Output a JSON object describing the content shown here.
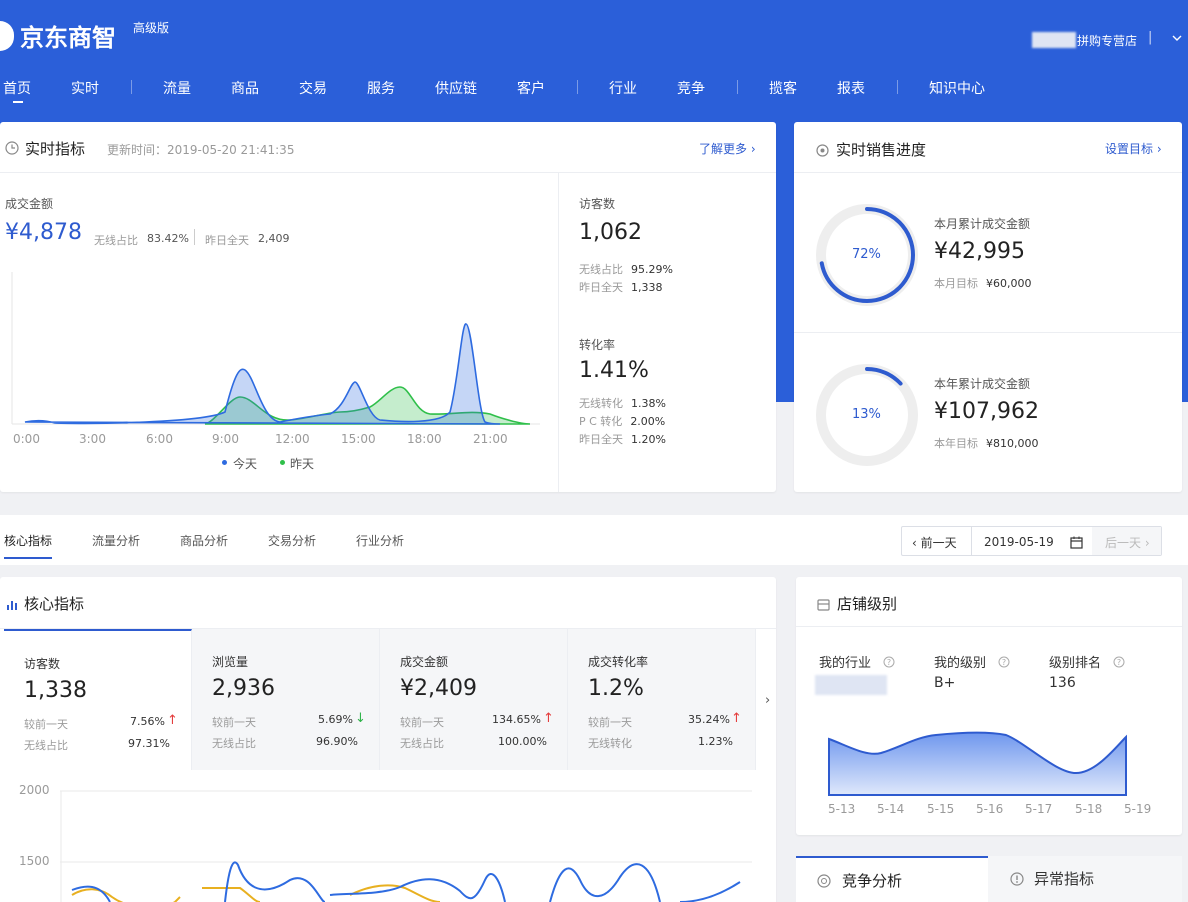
{
  "header": {
    "brand": "京东商智",
    "edition": "高级版",
    "shop_name": "拼购专营店",
    "separator": "|",
    "nav": [
      "首页",
      "实时",
      "流量",
      "商品",
      "交易",
      "服务",
      "供应链",
      "客户",
      "行业",
      "竞争",
      "揽客",
      "报表",
      "知识中心"
    ]
  },
  "realtime": {
    "title": "实时指标",
    "updated": "更新时间：2019-05-20 21:41:35",
    "more": "了解更多 ›",
    "gmv_label": "成交金额",
    "gmv_value": "¥4,878",
    "wireless_label": "无线占比",
    "wireless_value": "83.42%",
    "yesterday_label": "昨日全天",
    "yesterday_value": "2,409",
    "legend_today": "今天",
    "legend_yesterday": "昨天",
    "visitors_label": "访客数",
    "visitors_value": "1,062",
    "visitors_wireless_label": "无线占比",
    "visitors_wireless_value": "95.29%",
    "visitors_yesterday_label": "昨日全天",
    "visitors_yesterday_value": "1,338",
    "conv_label": "转化率",
    "conv_value": "1.41%",
    "conv_wireless_label": "无线转化",
    "conv_wireless_value": "1.38%",
    "conv_pc_label": "P C 转化",
    "conv_pc_value": "2.00%",
    "conv_yesterday_label": "昨日全天",
    "conv_yesterday_value": "1.20%"
  },
  "sales_progress": {
    "title": "实时销售进度",
    "set_goal": "设置目标 ›",
    "month": {
      "percent_label": "72%",
      "percent": 72,
      "label": "本月累计成交金额",
      "value": "¥42,995",
      "goal_label": "本月目标",
      "goal_value": "¥60,000"
    },
    "year": {
      "percent_label": "13%",
      "percent": 13,
      "label": "本年累计成交金额",
      "value": "¥107,962",
      "goal_label": "本年目标",
      "goal_value": "¥810,000"
    }
  },
  "analysis_tabs": [
    "核心指标",
    "流量分析",
    "商品分析",
    "交易分析",
    "行业分析"
  ],
  "date_nav": {
    "prev": "‹ 前一天",
    "date": "2019-05-19",
    "next": "后一天 ›"
  },
  "core": {
    "title": "核心指标",
    "metrics": [
      {
        "label": "访客数",
        "value": "1,338",
        "cmp_label": "较前一天",
        "cmp_value": "7.56%",
        "dir": "up",
        "sub_label": "无线占比",
        "sub_value": "97.31%"
      },
      {
        "label": "浏览量",
        "value": "2,936",
        "cmp_label": "较前一天",
        "cmp_value": "5.69%",
        "dir": "down",
        "sub_label": "无线占比",
        "sub_value": "96.90%"
      },
      {
        "label": "成交金额",
        "value": "¥2,409",
        "cmp_label": "较前一天",
        "cmp_value": "134.65%",
        "dir": "up",
        "sub_label": "无线占比",
        "sub_value": "100.00%"
      },
      {
        "label": "成交转化率",
        "value": "1.2%",
        "cmp_label": "较前一天",
        "cmp_value": "35.24%",
        "dir": "up",
        "sub_label": "无线转化",
        "sub_value": "1.23%"
      }
    ],
    "next_arrow": "›",
    "y_ticks": [
      "2000",
      "1500"
    ]
  },
  "shop_level": {
    "title": "店铺级别",
    "industry_label": "我的行业",
    "level_label": "我的级别",
    "level_value": "B+",
    "rank_label": "级别排名",
    "rank_value": "136",
    "days": [
      "5-13",
      "5-14",
      "5-15",
      "5-16",
      "5-17",
      "5-18",
      "5-19"
    ]
  },
  "bottom_tabs": {
    "competition": "竞争分析",
    "anomaly": "异常指标"
  },
  "colors": {
    "primary": "#2b5fd9",
    "today": "#2e6be0",
    "yesterday": "#2fbf4a",
    "up": "#e43c3c",
    "down": "#2fb34a"
  },
  "icons": [
    "clock-icon",
    "target-icon",
    "bar-chart-icon",
    "store-icon",
    "calendar-icon",
    "radar-icon",
    "warning-icon",
    "help-icon",
    "arrow-up-icon",
    "arrow-down-icon"
  ]
}
